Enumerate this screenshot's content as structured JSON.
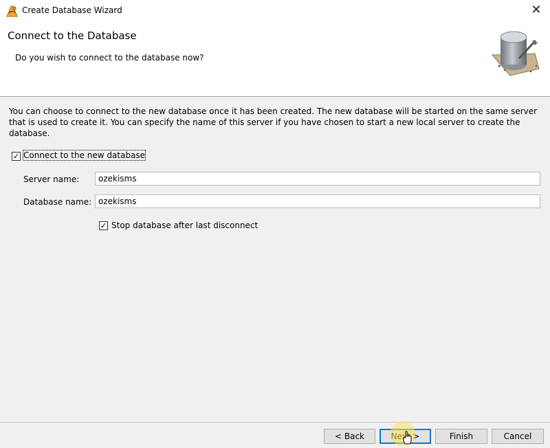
{
  "window": {
    "title": "Create Database Wizard",
    "close_label": "✕"
  },
  "header": {
    "title": "Connect to the Database",
    "subtitle": "Do you wish to connect to the database now?",
    "image_icon": "database-cylinder-icon"
  },
  "main": {
    "description": "You can choose to connect to the new database once it has been created. The new database will be started on the same server that is used to create it. You can specify the name of this server if you have chosen to start a new local server to create the database.",
    "connect_checkbox": {
      "label": "Connect to the new database",
      "checked": true
    },
    "server_name": {
      "label": "Server name:",
      "value": "ozekisms"
    },
    "database_name": {
      "label": "Database name:",
      "value": "ozekisms"
    },
    "stop_checkbox": {
      "label": "Stop database after last disconnect",
      "checked": true
    }
  },
  "footer": {
    "back_label": "< Back",
    "next_label": "Next >",
    "finish_label": "Finish",
    "cancel_label": "Cancel"
  },
  "colors": {
    "accent": "#0078d7",
    "panel_bg": "#f0f0f0"
  }
}
